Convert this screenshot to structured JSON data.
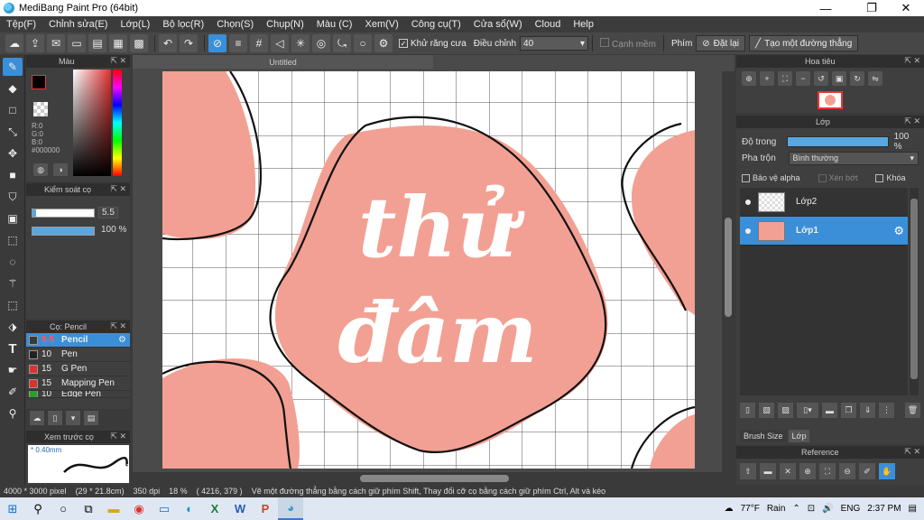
{
  "window": {
    "title": "MediBang Paint Pro (64bit)",
    "minimize": "—",
    "maximize": "❐",
    "close": "✕"
  },
  "menu": [
    "Tệp(F)",
    "Chỉnh sửa(E)",
    "Lớp(L)",
    "Bộ lọc(R)",
    "Chọn(S)",
    "Chụp(N)",
    "Màu (C)",
    "Xem(V)",
    "Công cụ(T)",
    "Cửa sổ(W)",
    "Cloud",
    "Help"
  ],
  "toolbar": {
    "antialias_label": "Khử răng cưa",
    "correction_label": "Điều chỉnh",
    "correction_value": "40",
    "smooth_label": "Cạnh mềm",
    "pen_label": "Phím",
    "reset_label": "Đặt lại",
    "straight_line_label": "Tạo một đường thẳng"
  },
  "color_panel": {
    "title": "Màu",
    "rgb_r": "R:0",
    "rgb_g": "G:0",
    "rgb_b": "B:0",
    "hex": "#000000"
  },
  "brush_control": {
    "title": "Kiểm soát cọ",
    "size_value": "5.5",
    "opacity_value": "100 %",
    "size_fraction": 0.06,
    "opacity_fraction": 1.0
  },
  "brush_list": {
    "title": "Cọ: Pencil",
    "items": [
      {
        "size": "5.5",
        "name": "Pencil",
        "color": "#3a3a3a"
      },
      {
        "size": "10",
        "name": "Pen",
        "color": "#222222"
      },
      {
        "size": "15",
        "name": "G Pen",
        "color": "#e03030"
      },
      {
        "size": "15",
        "name": "Mapping Pen",
        "color": "#e03030"
      },
      {
        "size": "10",
        "name": "Edge Pen",
        "color": "#2aa02a"
      }
    ]
  },
  "preview": {
    "title": "Xem trước cọ",
    "size_label": "* 0.40mm"
  },
  "canvas": {
    "tab_title": "Untitled",
    "text_line1": "thử",
    "text_line2": "đâm"
  },
  "navigator": {
    "title": "Hoa tiêu"
  },
  "layer_panel": {
    "title": "Lớp",
    "opacity_label": "Độ trong",
    "opacity_value": "100 %",
    "blend_label": "Pha trộn",
    "blend_value": "Bình thường",
    "protect_alpha": "Bảo vệ alpha",
    "clipping": "Xén bớt",
    "lock": "Khóa",
    "layers": [
      {
        "name": "Lớp2",
        "selected": false
      },
      {
        "name": "Lớp1",
        "selected": true
      }
    ],
    "tab_brush_size": "Brush Size",
    "tab_layer": "Lớp"
  },
  "reference": {
    "title": "Reference"
  },
  "status": {
    "canvas_size": "4000 * 3000 pixel",
    "physical_size": "(29 * 21.8cm)",
    "dpi": "350 dpi",
    "zoom": "18 %",
    "coords": "( 4216, 379 )",
    "hint": "Vẽ một đường thẳng bằng cách giữ phím Shift, Thay đổi cỡ cọ bằng cách giữ phím Ctrl, Alt và kéo"
  },
  "taskbar": {
    "weather_temp": "77°F",
    "weather_cond": "Rain",
    "lang": "ENG",
    "time": "2:37 PM"
  },
  "colors": {
    "accent": "#3a8fd8",
    "blob": "#f2a093",
    "panel": "#3f3f3f"
  }
}
